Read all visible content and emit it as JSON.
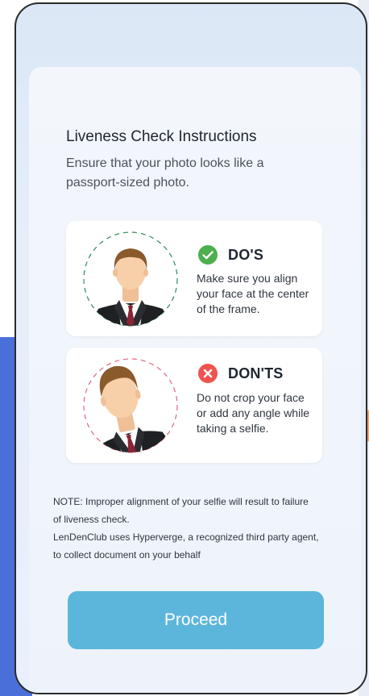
{
  "instructions": {
    "title": "Liveness Check Instructions",
    "subtitle": "Ensure that your photo looks like a passport-sized photo."
  },
  "dos": {
    "icon": "check-circle-icon",
    "title": "DO'S",
    "text": "Make sure you align your face at the center of the frame.",
    "color": "#4caf50"
  },
  "donts": {
    "icon": "x-circle-icon",
    "title": "DON'TS",
    "text": "Do not crop your face or add any angle while taking a selfie.",
    "color": "#ef5350"
  },
  "note": {
    "line1": "NOTE: Improper alignment of your selfie will result to failure of liveness check.",
    "line2": "LenDenClub uses Hyperverge, a recognized third party agent, to collect document on your behalf"
  },
  "proceed": {
    "label": "Proceed",
    "color": "#5cb6dc"
  }
}
